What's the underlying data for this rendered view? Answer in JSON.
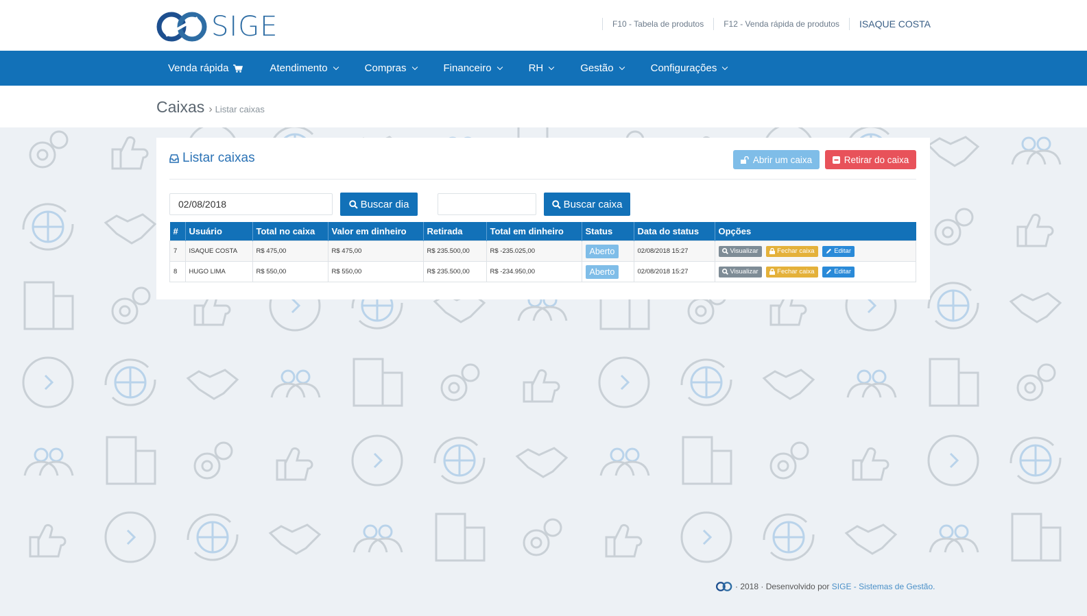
{
  "brand": {
    "name": "SIGE"
  },
  "top_links": {
    "f10": "F10 - Tabela de produtos",
    "f12": "F12 - Venda rápida de produtos",
    "user": "ISAQUE COSTA"
  },
  "nav": {
    "items": [
      {
        "label": "Venda rápida"
      },
      {
        "label": "Atendimento"
      },
      {
        "label": "Compras"
      },
      {
        "label": "Financeiro"
      },
      {
        "label": "RH"
      },
      {
        "label": "Gestão"
      },
      {
        "label": "Configurações"
      }
    ]
  },
  "page": {
    "title": "Caixas",
    "breadcrumb_sep": "›",
    "breadcrumb": "Listar caixas"
  },
  "panel": {
    "title": "Listar caixas",
    "open_button": "Abrir um caixa",
    "withdraw_button": "Retirar do caixa",
    "date_value": "02/08/2018",
    "caixa_value": "",
    "search_day_button": "Buscar dia",
    "search_caixa_button": "Buscar caixa"
  },
  "table": {
    "headers": [
      "#",
      "Usuário",
      "Total no caixa",
      "Valor em dinheiro",
      "Retirada",
      "Total em dinheiro",
      "Status",
      "Data do status",
      "Opções"
    ],
    "rows": [
      {
        "id": "7",
        "user": "ISAQUE COSTA",
        "total": "R$ 475,00",
        "cash": "R$ 475,00",
        "withdrawal": "R$ 235.500,00",
        "total_cash": "R$ -235.025,00",
        "status": "Aberto",
        "status_date": "02/08/2018 15:27"
      },
      {
        "id": "8",
        "user": "HUGO LIMA",
        "total": "R$ 550,00",
        "cash": "R$ 550,00",
        "withdrawal": "R$ 235.500,00",
        "total_cash": "R$ -234.950,00",
        "status": "Aberto",
        "status_date": "02/08/2018 15:27"
      }
    ],
    "actions": {
      "view": "Visualizar",
      "close": "Fechar caixa",
      "edit": "Editar"
    }
  },
  "footer": {
    "year_text": "· 2018 · Desenvolvido por",
    "link": "SIGE - Sistemas de Gestão."
  },
  "colors": {
    "primary": "#1271b8",
    "info": "#7fbde8",
    "danger": "#e8525a",
    "warning": "#e4b13a",
    "neutral": "#7e8c96",
    "background": "#edf1f5"
  }
}
